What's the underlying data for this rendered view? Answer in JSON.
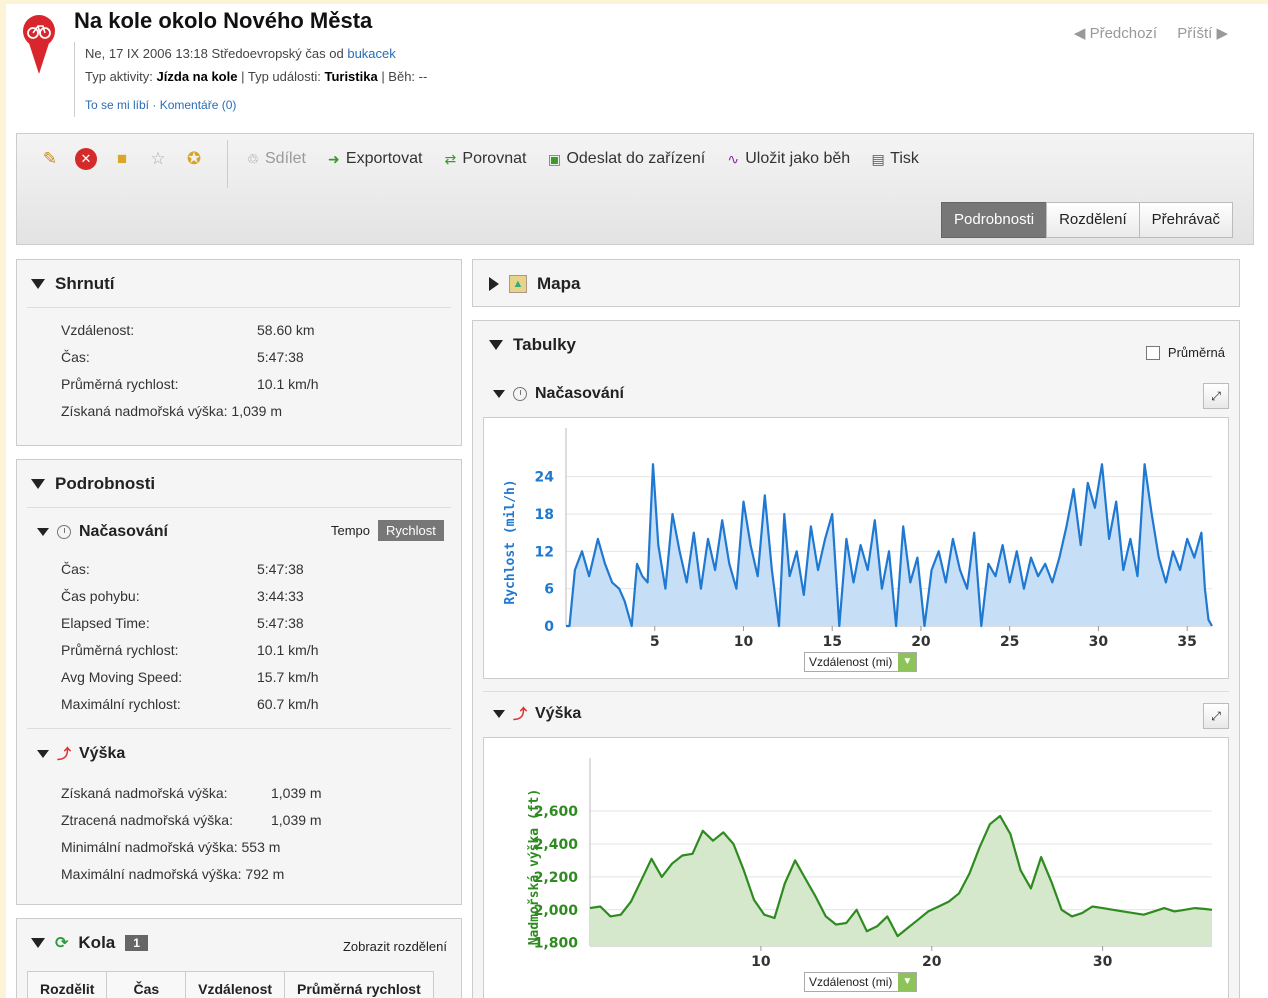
{
  "header": {
    "title": "Na kole okolo Nového Města",
    "date_line": "Ne, 17 IX 2006 13:18 Středoevropský čas od",
    "author": "bukacek",
    "activity_label": "Typ aktivity:",
    "activity_value": "Jízda na kole",
    "event_label": "| Typ události:",
    "event_value": "Turistika",
    "run_label": "| Běh: --",
    "like": "To se mi líbí",
    "comments": "· Komentáře (0)",
    "prev": "Předchozí",
    "next": "Příští"
  },
  "toolbar": {
    "share": "Sdílet",
    "export": "Exportovat",
    "compare": "Porovnat",
    "send": "Odeslat do zařízení",
    "save_run": "Uložit jako běh",
    "print": "Tisk",
    "tabs": [
      "Podrobnosti",
      "Rozdělení",
      "Přehrávač"
    ]
  },
  "summary": {
    "title": "Shrnutí",
    "rows": [
      {
        "k": "Vzdálenost:",
        "v": "58.60 km"
      },
      {
        "k": "Čas:",
        "v": "5:47:38"
      },
      {
        "k": "Průměrná rychlost:",
        "v": "10.1 km/h"
      },
      {
        "k": "Získaná nadmořská výška:",
        "v": "1,039 m"
      }
    ]
  },
  "details": {
    "title": "Podrobnosti",
    "timing_title": "Načasování",
    "toggle_a": "Tempo",
    "toggle_b": "Rychlost",
    "timing": [
      {
        "k": "Čas:",
        "v": "5:47:38"
      },
      {
        "k": "Čas pohybu:",
        "v": "3:44:33"
      },
      {
        "k": "Elapsed Time:",
        "v": "5:47:38"
      },
      {
        "k": "Průměrná rychlost:",
        "v": "10.1 km/h"
      },
      {
        "k": "Avg Moving Speed:",
        "v": "15.7 km/h"
      },
      {
        "k": "Maximální rychlost:",
        "v": "60.7 km/h"
      }
    ],
    "elev_title": "Výška",
    "elevation": [
      {
        "k": "Získaná nadmořská výška:",
        "v": "1,039 m"
      },
      {
        "k": "Ztracená nadmořská výška:",
        "v": "1,039 m"
      },
      {
        "k": "Minimální nadmořská výška:",
        "v": "553 m"
      },
      {
        "k": "Maximální nadmořská výška:",
        "v": "792 m"
      }
    ]
  },
  "laps": {
    "title": "Kola",
    "count": "1",
    "link": "Zobrazit rozdělení",
    "cols": [
      "Rozdělit",
      "Čas",
      "Vzdálenost",
      "Průměrná rychlost"
    ]
  },
  "map": {
    "title": "Mapa"
  },
  "charts": {
    "title": "Tabulky",
    "avg_label": "Průměrná",
    "timing_title": "Načasování",
    "elev_title": "Výška",
    "xsel": "Vzdálenost (mi)"
  },
  "chart_data": [
    {
      "type": "area",
      "ylabel": "Rychlost (mil/h)",
      "xlabel": "Vzdálenost (mi)",
      "xlim": [
        0,
        36.4
      ],
      "ylim": [
        0,
        27
      ],
      "xticks": [
        5,
        10,
        15,
        20,
        25,
        30,
        35
      ],
      "yticks": [
        0,
        6,
        12,
        18,
        24
      ],
      "color": "#1f78d1",
      "x": [
        0,
        0.2,
        0.5,
        0.9,
        1.3,
        1.8,
        2.2,
        2.6,
        3.0,
        3.3,
        3.7,
        4.0,
        4.3,
        4.6,
        4.9,
        5.2,
        5.6,
        6.0,
        6.4,
        6.8,
        7.2,
        7.6,
        8.0,
        8.4,
        8.8,
        9.2,
        9.6,
        10.0,
        10.4,
        10.8,
        11.2,
        11.6,
        12.0,
        12.3,
        12.6,
        13.0,
        13.4,
        13.8,
        14.2,
        14.6,
        15.0,
        15.4,
        15.8,
        16.2,
        16.6,
        17.0,
        17.4,
        17.8,
        18.2,
        18.6,
        19.0,
        19.4,
        19.8,
        20.2,
        20.6,
        21.0,
        21.4,
        21.8,
        22.2,
        22.6,
        23.0,
        23.4,
        23.8,
        24.2,
        24.6,
        25.0,
        25.4,
        25.8,
        26.2,
        26.6,
        27.0,
        27.4,
        27.8,
        28.2,
        28.6,
        29.0,
        29.4,
        29.8,
        30.2,
        30.6,
        31.0,
        31.4,
        31.8,
        32.2,
        32.6,
        33.0,
        33.4,
        33.8,
        34.2,
        34.6,
        35.0,
        35.4,
        35.8,
        36.0,
        36.2,
        36.4
      ],
      "y": [
        0,
        0,
        9,
        12,
        8,
        14,
        10,
        7,
        6,
        4,
        0,
        10,
        8,
        7,
        26,
        13,
        6,
        18,
        12,
        7,
        15,
        6,
        14,
        9,
        17,
        10,
        6,
        20,
        13,
        8,
        21,
        9,
        0,
        18,
        8,
        12,
        5,
        16,
        9,
        14,
        18,
        0,
        14,
        7,
        13,
        9,
        17,
        6,
        12,
        0,
        16,
        7,
        11,
        0,
        9,
        12,
        7,
        14,
        9,
        6,
        15,
        0,
        10,
        8,
        13,
        7,
        12,
        6,
        11,
        8,
        10,
        7,
        11,
        16,
        22,
        13,
        23,
        19,
        26,
        14,
        20,
        9,
        14,
        8,
        26,
        18,
        11,
        7,
        12,
        9,
        14,
        11,
        15,
        6,
        1,
        0
      ]
    },
    {
      "type": "area",
      "ylabel": "Nadmořská výška (ft)",
      "xlabel": "Vzdálenost (mi)",
      "xlim": [
        0,
        36.4
      ],
      "ylim": [
        1780,
        2740
      ],
      "xticks": [
        10,
        20,
        30
      ],
      "yticks": [
        1800,
        2000,
        2200,
        2400,
        2600
      ],
      "ytick_labels": [
        "1,800",
        "2,000",
        "2,200",
        "2,400",
        "2,600"
      ],
      "color": "#2e8b1f",
      "x": [
        0,
        0.6,
        1.2,
        1.8,
        2.4,
        3.0,
        3.6,
        4.2,
        4.8,
        5.4,
        6.0,
        6.6,
        7.2,
        7.8,
        8.4,
        9.0,
        9.6,
        10.2,
        10.8,
        11.4,
        12.0,
        12.6,
        13.2,
        13.8,
        14.4,
        15.0,
        15.6,
        16.2,
        16.8,
        17.4,
        18.0,
        18.6,
        19.2,
        19.8,
        20.4,
        21.0,
        21.6,
        22.2,
        22.8,
        23.4,
        24.0,
        24.6,
        25.2,
        25.8,
        26.4,
        27.0,
        27.6,
        28.2,
        28.8,
        29.4,
        30.0,
        30.6,
        31.2,
        31.8,
        32.4,
        33.0,
        33.6,
        34.2,
        34.8,
        35.4,
        36.0,
        36.4
      ],
      "y": [
        2010,
        2020,
        1960,
        1970,
        2050,
        2180,
        2310,
        2200,
        2280,
        2330,
        2340,
        2480,
        2420,
        2470,
        2400,
        2240,
        2060,
        1970,
        1950,
        2160,
        2300,
        2190,
        2080,
        1960,
        1910,
        1920,
        2000,
        1870,
        1900,
        1960,
        1840,
        1890,
        1940,
        1990,
        2020,
        2050,
        2100,
        2220,
        2380,
        2520,
        2570,
        2460,
        2240,
        2130,
        2320,
        2170,
        2000,
        1960,
        1980,
        2020,
        2010,
        2000,
        1990,
        1980,
        1970,
        1990,
        2010,
        1990,
        2000,
        2010,
        2005,
        2000
      ]
    }
  ]
}
